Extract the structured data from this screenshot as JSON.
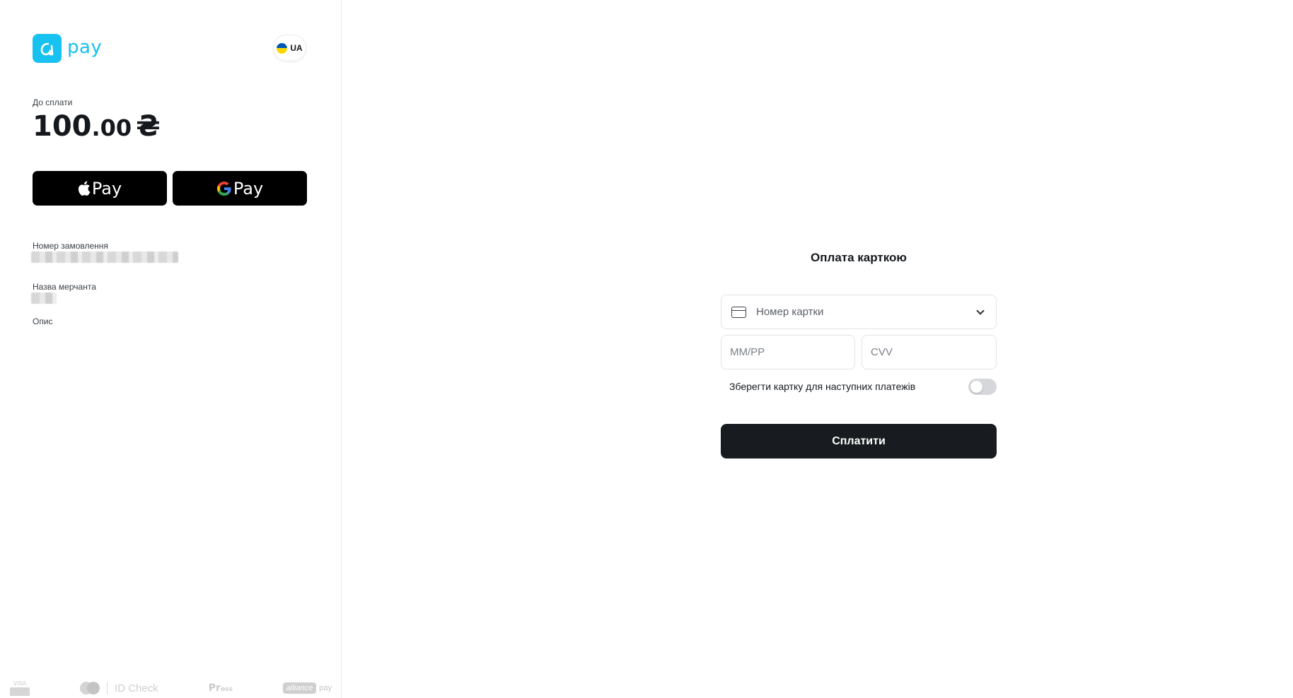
{
  "brand": {
    "name": "pay",
    "accent_color": "#17c1f0"
  },
  "language": {
    "current": "UA"
  },
  "payment": {
    "amount_label": "До сплати",
    "amount_integer": "100",
    "amount_decimal": ".00",
    "currency_symbol": "₴"
  },
  "wallets": {
    "apple_pay_label": "Pay",
    "google_pay_label": "Pay"
  },
  "order": {
    "order_number_label": "Номер замовлення",
    "merchant_label": "Назва мерчанта",
    "description_label": "Опис"
  },
  "footer_logos": {
    "visa": "VISA",
    "visa_sub": "SECURE",
    "mastercard_id": "ID Check",
    "prostir": "Prostir",
    "alliance": "alliance",
    "alliance_pay": "pay"
  },
  "card_form": {
    "title": "Оплата карткою",
    "card_number_placeholder": "Номер картки",
    "expiry_placeholder": "ММ/РР",
    "cvv_placeholder": "CVV",
    "save_card_label": "Зберегти картку для наступних платежів",
    "save_card_enabled": false,
    "pay_button_label": "Сплатити"
  }
}
